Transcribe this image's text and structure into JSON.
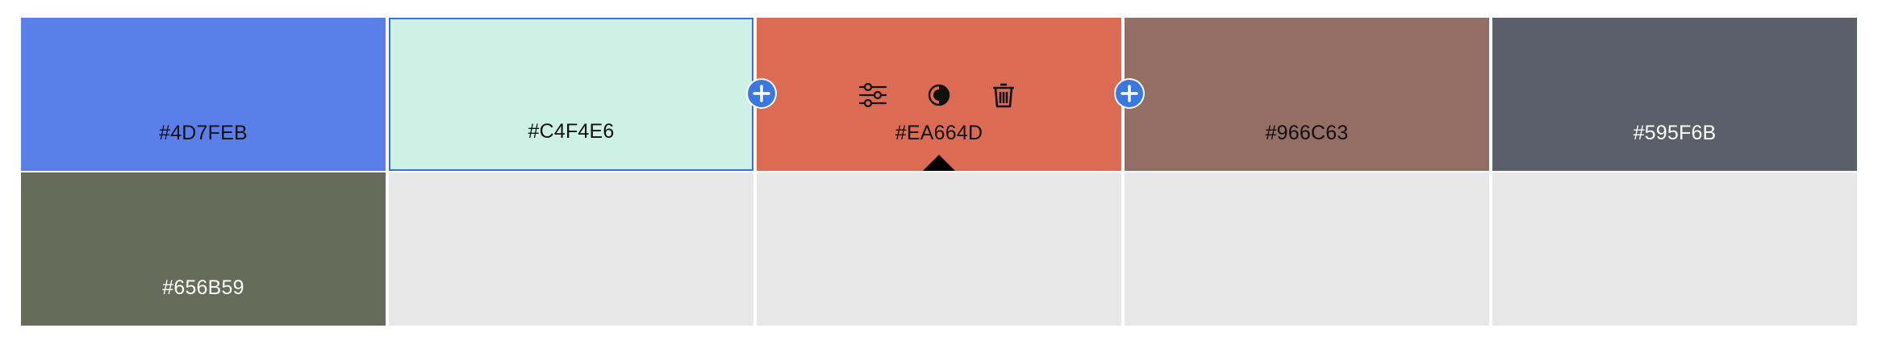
{
  "palette": {
    "swatches": [
      {
        "hex": "#4D7FEB",
        "label": "#4D7FEB",
        "text_color": "#111111"
      },
      {
        "hex": "#C4F4E6",
        "label": "#C4F4E6",
        "text_color": "#111111"
      },
      {
        "hex": "#EA664D",
        "label": "#EA664D",
        "text_color": "#111111"
      },
      {
        "hex": "#966C63",
        "label": "#966C63",
        "text_color": "#111111"
      },
      {
        "hex": "#595F6B",
        "label": "#595F6B",
        "text_color": "#ffffff"
      },
      {
        "hex": "#656B59",
        "label": "#656B59",
        "text_color": "#ffffff"
      }
    ],
    "selected_index": 1,
    "active_index": 2,
    "empty_color": "#e8e8e8"
  },
  "toolbar": {
    "adjust_icon": "sliders-icon",
    "contrast_icon": "contrast-icon",
    "delete_icon": "trash-icon",
    "add_icon": "plus-circle-icon"
  },
  "colors": {
    "accent": "#3a78e0",
    "selection_border": "#3a6fd9"
  }
}
